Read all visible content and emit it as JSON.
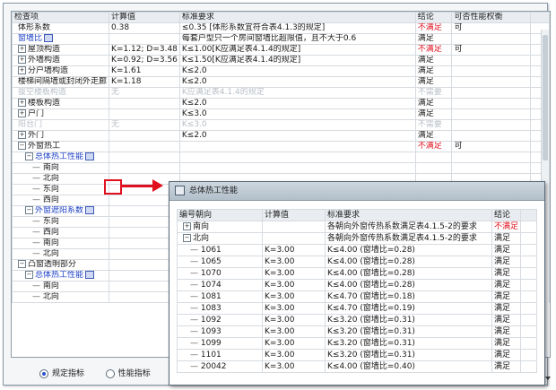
{
  "main": {
    "headers": [
      "检查项",
      "计算值",
      "标准要求",
      "结论",
      "可否性能权衡"
    ],
    "rows": [
      {
        "level": 0,
        "expander": "",
        "name": "体形系数",
        "value": "0.38",
        "req": "≤0.35 [体形系数宜符合表4.1.3的规定]",
        "result": "不满足",
        "result_fail": true,
        "tradeoff": "可"
      },
      {
        "level": 0,
        "expander": "",
        "name": "窗墙比",
        "name_blue": true,
        "icon": true,
        "value": "",
        "req": "每套户型只一个房间窗墙比超限值，且不大于0.6",
        "result": "满足",
        "tradeoff": ""
      },
      {
        "level": 0,
        "expander": "+",
        "name": "屋顶构造",
        "value": "K=1.12; D=3.48",
        "req": "K≤1.00[K应满足表4.1.4的规定]",
        "result": "不满足",
        "result_fail": true,
        "tradeoff": "可"
      },
      {
        "level": 0,
        "expander": "+",
        "name": "外墙构造",
        "value": "K=0.92; D=3.56",
        "req": "K≤1.50[K应满足表4.1.4的规定]",
        "result": "满足",
        "tradeoff": ""
      },
      {
        "level": 0,
        "expander": "+",
        "name": "分户墙构造",
        "value": "K=1.61",
        "req": "K≤2.0",
        "result": "满足",
        "tradeoff": ""
      },
      {
        "level": 0,
        "expander": "",
        "name": "楼梯间隔墙或封闭外走廊",
        "value": "K=1.18",
        "req": "K≤2.0",
        "result": "满足",
        "tradeoff": ""
      },
      {
        "level": 0,
        "expander": "",
        "name": "拔空楼板构造",
        "gray": true,
        "value": "无",
        "req": "K应满足表4.1.4的规定",
        "result": "不需要",
        "tradeoff": ""
      },
      {
        "level": 0,
        "expander": "+",
        "name": "楼板构造",
        "value": "",
        "req": "K≤2.0",
        "result": "满足",
        "tradeoff": ""
      },
      {
        "level": 0,
        "expander": "+",
        "name": "户门",
        "value": "",
        "req": "K≤3.0",
        "result": "满足",
        "tradeoff": ""
      },
      {
        "level": 0,
        "expander": "",
        "name": "阳台门",
        "gray": true,
        "value": "无",
        "req": "K≤3.0",
        "result": "不需要",
        "tradeoff": ""
      },
      {
        "level": 0,
        "expander": "+",
        "name": "外门",
        "value": "",
        "req": "K≤2.0",
        "result": "满足",
        "tradeoff": ""
      },
      {
        "level": 0,
        "expander": "−",
        "name": "外窗热工",
        "value": "",
        "req": "",
        "result": "不满足",
        "result_fail": true,
        "tradeoff": "可"
      },
      {
        "level": 1,
        "expander": "−",
        "name": "总体热工性能",
        "name_blue": true,
        "icon": true,
        "value": "",
        "req": "",
        "result": "",
        "tradeoff": ""
      },
      {
        "level": 2,
        "expander": "",
        "name": "南向",
        "value": "",
        "req": "",
        "result": "",
        "tradeoff": ""
      },
      {
        "level": 2,
        "expander": "",
        "name": "北向",
        "value": "",
        "req": "",
        "result": "",
        "tradeoff": ""
      },
      {
        "level": 2,
        "expander": "",
        "name": "东向",
        "value": "",
        "req": "",
        "result": "",
        "tradeoff": ""
      },
      {
        "level": 2,
        "expander": "",
        "name": "西向",
        "value": "",
        "req": "",
        "result": "",
        "tradeoff": ""
      },
      {
        "level": 1,
        "expander": "−",
        "name": "外窗遮阳系数",
        "name_blue": true,
        "icon": true,
        "value": "",
        "req": "",
        "result": "",
        "tradeoff": ""
      },
      {
        "level": 2,
        "expander": "",
        "name": "东向",
        "value": "",
        "req": "",
        "result": "",
        "tradeoff": ""
      },
      {
        "level": 2,
        "expander": "",
        "name": "西向",
        "value": "",
        "req": "",
        "result": "",
        "tradeoff": ""
      },
      {
        "level": 2,
        "expander": "",
        "name": "南向",
        "value": "",
        "req": "",
        "result": "",
        "tradeoff": ""
      },
      {
        "level": 2,
        "expander": "",
        "name": "北向",
        "value": "",
        "req": "",
        "result": "",
        "tradeoff": ""
      },
      {
        "level": 0,
        "expander": "−",
        "name": "凸窗透明部分",
        "value": "",
        "req": "",
        "result": "",
        "tradeoff": ""
      },
      {
        "level": 1,
        "expander": "−",
        "name": "总体热工性能",
        "name_blue": true,
        "icon": true,
        "value": "",
        "req": "",
        "result": "",
        "tradeoff": ""
      },
      {
        "level": 2,
        "expander": "",
        "name": "南向",
        "value": "",
        "req": "",
        "result": "",
        "tradeoff": ""
      },
      {
        "level": 2,
        "expander": "",
        "name": "北向",
        "value": "",
        "req": "",
        "result": "",
        "tradeoff": ""
      }
    ]
  },
  "popup": {
    "title": "总体热工性能",
    "headers": [
      "编号朝向",
      "计算值",
      "标准要求",
      "结论"
    ],
    "rows": [
      {
        "expander": "+",
        "name": "南向",
        "value": "",
        "req": "各朝向外窗传热系数满足表4.1.5-2的要求",
        "result": "不满足",
        "result_fail": true
      },
      {
        "expander": "−",
        "name": "北向",
        "value": "",
        "req": "各朝向外窗传热系数满足表4.1.5-2的要求",
        "result": "满足"
      },
      {
        "expander": "",
        "name": "1061",
        "child": true,
        "value": "K=3.00",
        "req": "K≤4.00 (窗墙比=0.28)",
        "result": "满足"
      },
      {
        "expander": "",
        "name": "1065",
        "child": true,
        "value": "K=3.00",
        "req": "K≤4.00 (窗墙比=0.28)",
        "result": "满足"
      },
      {
        "expander": "",
        "name": "1070",
        "child": true,
        "value": "K=3.00",
        "req": "K≤4.00 (窗墙比=0.28)",
        "result": "满足"
      },
      {
        "expander": "",
        "name": "1074",
        "child": true,
        "value": "K=3.00",
        "req": "K≤4.00 (窗墙比=0.28)",
        "result": "满足"
      },
      {
        "expander": "",
        "name": "1081",
        "child": true,
        "value": "K=3.00",
        "req": "K≤4.70 (窗墙比=0.18)",
        "result": "满足"
      },
      {
        "expander": "",
        "name": "1083",
        "child": true,
        "value": "K=3.00",
        "req": "K≤4.70 (窗墙比=0.19)",
        "result": "满足"
      },
      {
        "expander": "",
        "name": "1092",
        "child": true,
        "value": "K=3.00",
        "req": "K≤3.20 (窗墙比=0.31)",
        "result": "满足"
      },
      {
        "expander": "",
        "name": "1093",
        "child": true,
        "value": "K=3.00",
        "req": "K≤3.20 (窗墙比=0.31)",
        "result": "满足"
      },
      {
        "expander": "",
        "name": "1099",
        "child": true,
        "value": "K=3.00",
        "req": "K≤3.20 (窗墙比=0.31)",
        "result": "满足"
      },
      {
        "expander": "",
        "name": "1101",
        "child": true,
        "value": "K=3.00",
        "req": "K≤3.20 (窗墙比=0.31)",
        "result": "满足"
      },
      {
        "expander": "",
        "name": "20042",
        "child": true,
        "value": "K=3.00",
        "req": "K≤4.00 (窗墙比=0.40)",
        "result": "满足"
      }
    ]
  },
  "footer": {
    "radio1_label": "规定指标",
    "radio2_label": "性能指标"
  },
  "colors": {
    "fail": "#e0101e",
    "link": "#1c3fc4",
    "highlight": "#e0101e"
  }
}
